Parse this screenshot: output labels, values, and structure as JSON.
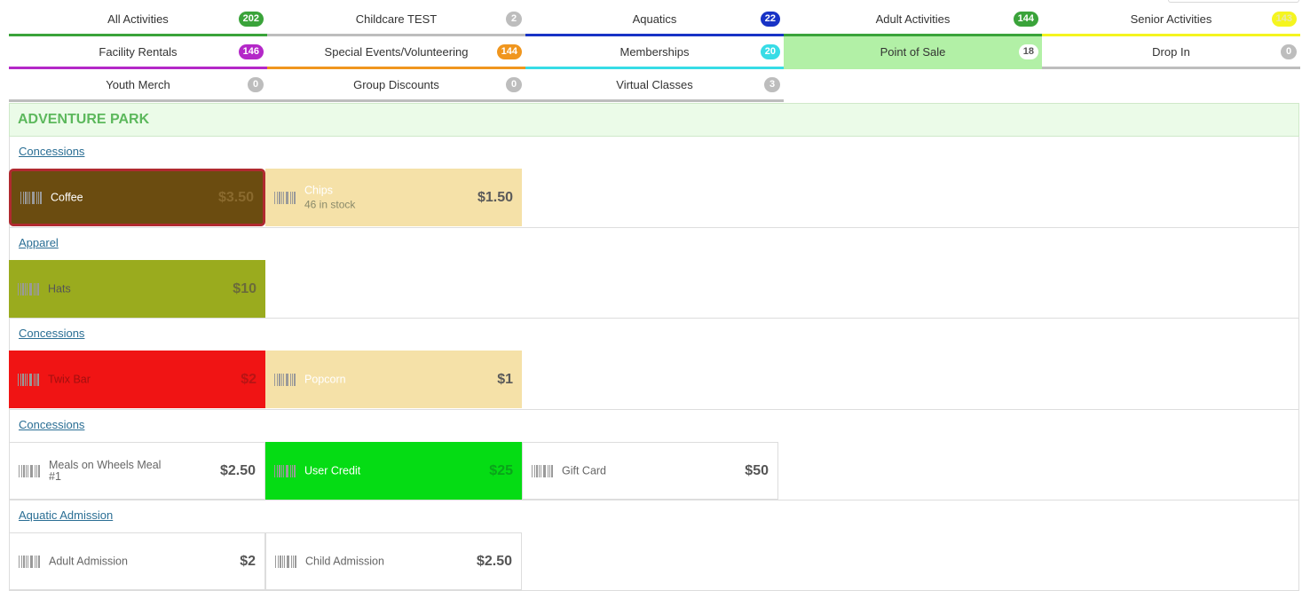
{
  "tabs": [
    {
      "label": "All Activities",
      "count": "202",
      "badge_color": "#3aa33a",
      "underline": "#3aa33a"
    },
    {
      "label": "Childcare TEST",
      "count": "2",
      "badge_color": "#bdbdbd",
      "underline": "#bdbdbd"
    },
    {
      "label": "Aquatics",
      "count": "22",
      "badge_color": "#1833c6",
      "underline": "#1833c6"
    },
    {
      "label": "Adult Activities",
      "count": "144",
      "badge_color": "#3aa33a",
      "underline": "#3aa33a"
    },
    {
      "label": "Senior Activities",
      "count": "143",
      "badge_color": "#f5f51f",
      "underline": "#f5f51f"
    },
    {
      "label": "Facility Rentals",
      "count": "146",
      "badge_color": "#b428c8",
      "underline": "#b428c8"
    },
    {
      "label": "Special Events/Volunteering",
      "count": "144",
      "badge_color": "#f0961e",
      "underline": "#f0961e"
    },
    {
      "label": "Memberships",
      "count": "20",
      "badge_color": "#37dce6",
      "underline": "#37dce6"
    },
    {
      "label": "Point of Sale",
      "count": "18",
      "badge_color": "#ffffff",
      "underline": "#b2f0a6",
      "active": true
    },
    {
      "label": "Drop In",
      "count": "0",
      "badge_color": "#bdbdbd",
      "underline": "#bdbdbd"
    },
    {
      "label": "Youth Merch",
      "count": "0",
      "badge_color": "#bdbdbd",
      "underline": "#bdbdbd"
    },
    {
      "label": "Group Discounts",
      "count": "0",
      "badge_color": "#bdbdbd",
      "underline": "#bdbdbd"
    },
    {
      "label": "Virtual Classes",
      "count": "3",
      "badge_color": "#bdbdbd",
      "underline": "#bdbdbd"
    }
  ],
  "section": {
    "title": "ADVENTURE PARK"
  },
  "groups": [
    {
      "title": "Concessions",
      "items": [
        {
          "name": "Coffee",
          "price": "$3.50",
          "bg": "#6b4c10",
          "text_color": "#ffffff",
          "price_color": "#8a6a2e",
          "selected": true
        },
        {
          "name": "Chips",
          "stock": "46 in stock",
          "price": "$1.50",
          "bg": "#f5e1a8",
          "text_color": "#ffffff",
          "price_color": "#5a5a5a",
          "stock_color": "#8a8a6a"
        }
      ]
    },
    {
      "title": "Apparel",
      "items": [
        {
          "name": "Hats",
          "price": "$10",
          "bg": "#9aab1e",
          "text_color": "#555555",
          "price_color": "#6b6b3a"
        }
      ]
    },
    {
      "title": "Concessions",
      "items": [
        {
          "name": "Twix Bar",
          "price": "$2",
          "bg": "#f01414",
          "text_color": "#a10f0f",
          "price_color": "#b81414"
        },
        {
          "name": "Popcorn",
          "price": "$1",
          "bg": "#f5e1a8",
          "text_color": "#ffffff",
          "price_color": "#5a5a5a"
        }
      ]
    },
    {
      "title": "Concessions",
      "items": [
        {
          "name": "Meals on Wheels Meal #1",
          "price": "$2.50",
          "bg": "#ffffff",
          "text_color": "#666666",
          "price_color": "#555555",
          "bordered": true
        },
        {
          "name": "User Credit",
          "price": "$25",
          "bg": "#05dc14",
          "text_color": "#ffffff",
          "price_color": "#0aa31a"
        },
        {
          "name": "Gift Card",
          "price": "$50",
          "bg": "#ffffff",
          "text_color": "#666666",
          "price_color": "#555555",
          "bordered": true
        }
      ]
    },
    {
      "title": "Aquatic Admission",
      "items": [
        {
          "name": "Adult Admission",
          "price": "$2",
          "bg": "#ffffff",
          "text_color": "#666666",
          "price_color": "#555555",
          "bordered": true
        },
        {
          "name": "Child Admission",
          "price": "$2.50",
          "bg": "#ffffff",
          "text_color": "#666666",
          "price_color": "#555555",
          "bordered": true
        }
      ]
    }
  ]
}
